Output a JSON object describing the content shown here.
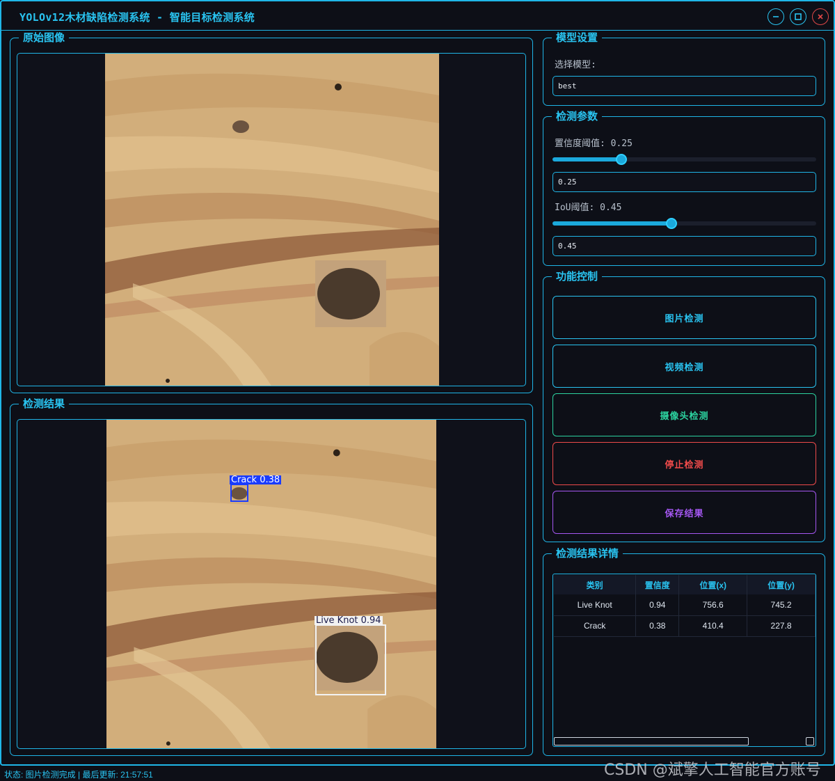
{
  "window": {
    "title": "YOLOv12木材缺陷检测系统 - 智能目标检测系统",
    "controls": [
      "minimize",
      "maximize",
      "close"
    ]
  },
  "original_panel": {
    "title": "原始图像"
  },
  "result_panel": {
    "title": "检测结果",
    "detections": [
      {
        "label": "Crack 0.38",
        "color": "#1a3cff"
      },
      {
        "label": "Live Knot 0.94",
        "color": "#f2f2f2"
      }
    ]
  },
  "model_settings": {
    "title": "模型设置",
    "select_label": "选择模型:",
    "selected_model": "best"
  },
  "params": {
    "title": "检测参数",
    "confidence": {
      "label": "置信度阈值: 0.25",
      "value": "0.25",
      "fraction": 0.25
    },
    "iou": {
      "label": "IoU阈值: 0.45",
      "value": "0.45",
      "fraction": 0.45
    }
  },
  "controls": {
    "title": "功能控制",
    "buttons": [
      {
        "label": "图片检测",
        "color": "#29c3f0"
      },
      {
        "label": "视频检测",
        "color": "#29c3f0"
      },
      {
        "label": "摄像头检测",
        "color": "#2cd3a0"
      },
      {
        "label": "停止检测",
        "color": "#f04b4b"
      },
      {
        "label": "保存结果",
        "color": "#a557f2"
      }
    ]
  },
  "details": {
    "title": "检测结果详情",
    "columns": [
      "类别",
      "置信度",
      "位置(x)",
      "位置(y)"
    ],
    "rows": [
      [
        "Live Knot",
        "0.94",
        "756.6",
        "745.2"
      ],
      [
        "Crack",
        "0.38",
        "410.4",
        "227.8"
      ]
    ]
  },
  "status": {
    "text": "状态: 图片检测完成 | 最后更新: 21:57:51"
  },
  "watermark": "CSDN @斌擎人工智能官方账号"
}
